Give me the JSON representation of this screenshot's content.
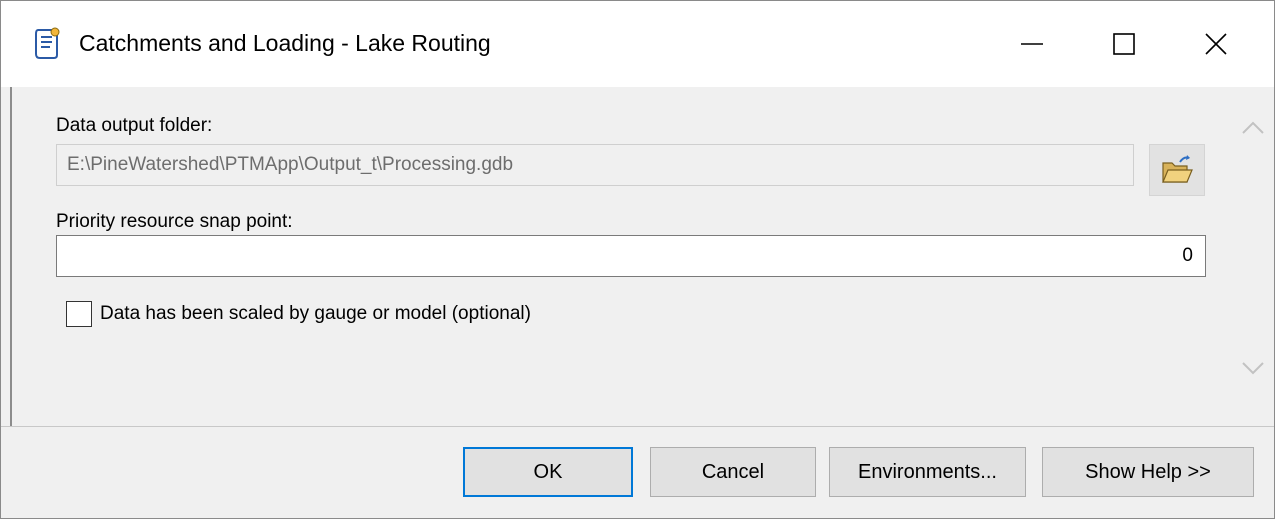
{
  "window": {
    "title": "Catchments and Loading - Lake Routing",
    "app_icon": "script-tool-icon",
    "controls": [
      "minimize-icon",
      "maximize-icon",
      "close-icon"
    ]
  },
  "form": {
    "output_folder": {
      "label": "Data output folder:",
      "value": "E:\\PineWatershed\\PTMApp\\Output_t\\Processing.gdb",
      "browse_icon": "open-folder-icon"
    },
    "snap_point": {
      "label": "Priority resource snap point:",
      "value": "0"
    },
    "scaled_checkbox": {
      "label": "Data has been scaled by gauge or model (optional)",
      "checked": false
    }
  },
  "buttons": {
    "ok": "OK",
    "cancel": "Cancel",
    "environments": "Environments...",
    "show_help": "Show Help >>"
  },
  "colors": {
    "default_button_border": "#0078d7",
    "dialog_bg": "#f0f0f0"
  }
}
